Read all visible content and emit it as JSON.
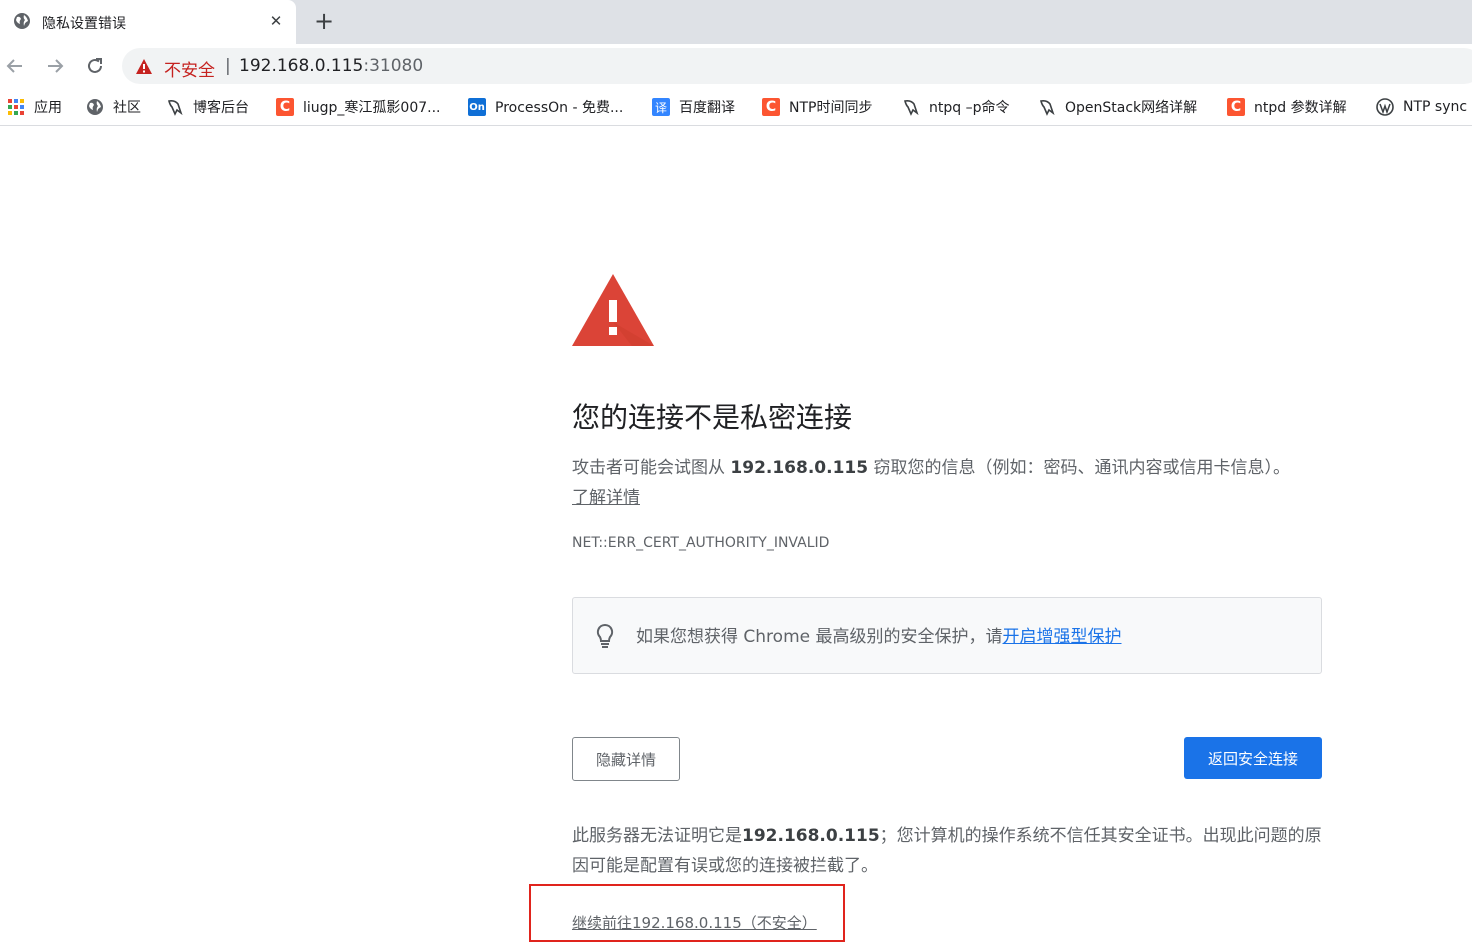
{
  "tab": {
    "title": "隐私设置错误",
    "close": "✕",
    "favicon": "globe-icon"
  },
  "new_tab": "+",
  "omnibox": {
    "security_label": "不安全",
    "separator": "|",
    "host": "192.168.0.115",
    "port": ":31080"
  },
  "bookmarks": [
    {
      "label": "应用",
      "icon": "apps-grid-icon"
    },
    {
      "label": "社区",
      "icon": "globe-icon"
    },
    {
      "label": "博客后台",
      "icon": "csdn-tool-icon"
    },
    {
      "label": "liugp_寒江孤影007...",
      "icon": "csdn-c-icon",
      "icon_text": "C"
    },
    {
      "label": "ProcessOn - 免费...",
      "icon": "processon-icon",
      "icon_text": "On"
    },
    {
      "label": "百度翻译",
      "icon": "baidu-translate-icon",
      "icon_text": "译"
    },
    {
      "label": "NTP时间同步",
      "icon": "csdn-c-icon",
      "icon_text": "C"
    },
    {
      "label": "ntpq –p命令",
      "icon": "csdn-tool-icon"
    },
    {
      "label": "OpenStack网络详解",
      "icon": "csdn-tool-icon"
    },
    {
      "label": "ntpd 参数详解",
      "icon": "csdn-c-icon",
      "icon_text": "C"
    },
    {
      "label": "NTP sync",
      "icon": "wordpress-icon"
    }
  ],
  "interstitial": {
    "heading": "您的连接不是私密连接",
    "explanation_prefix": "攻击者可能会试图从 ",
    "host": "192.168.0.115",
    "explanation_suffix": " 窃取您的信息（例如：密码、通讯内容或信用卡信息）。",
    "learn_more": "了解详情",
    "error_code": "NET::ERR_CERT_AUTHORITY_INVALID",
    "promo_text": "如果您想获得 Chrome 最高级别的安全保护，请",
    "promo_link": "开启增强型保护",
    "hide_details": "隐藏详情",
    "back_to_safety": "返回安全连接",
    "details_prefix": "此服务器无法证明它是",
    "details_host": "192.168.0.115",
    "details_suffix": "；您计算机的操作系统不信任其安全证书。出现此问题的原因可能是配置有误或您的连接被拦截了。",
    "proceed_link": "继续前往192.168.0.115（不安全）"
  },
  "colors": {
    "accent": "#1a73e8",
    "danger": "#c5221f",
    "warning_triangle": "#db4437",
    "annotation": "#e0241d"
  }
}
